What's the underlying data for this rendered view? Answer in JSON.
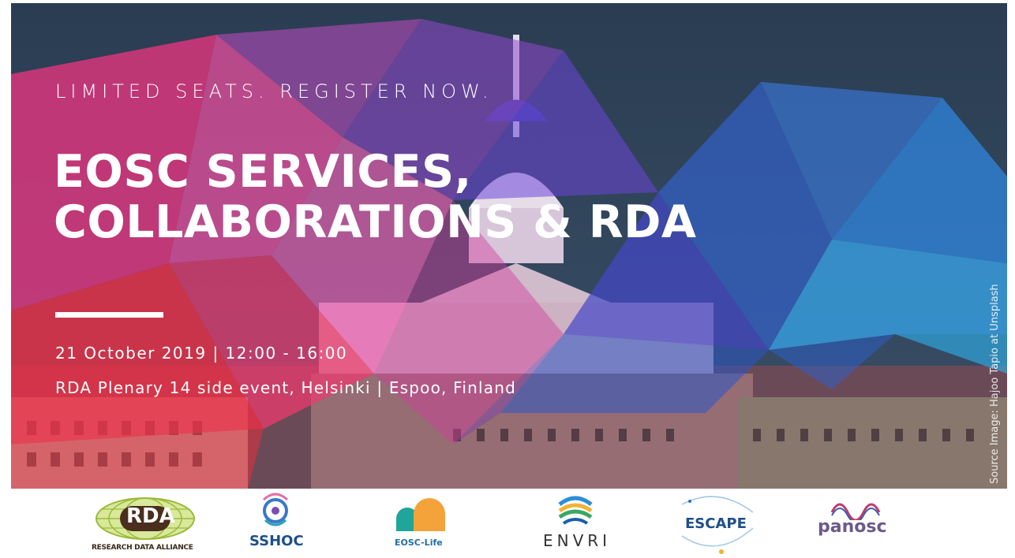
{
  "banner": {
    "tagline": "LIMITED SEATS. REGISTER NOW.",
    "title_line1": "EOSC SERVICES,",
    "title_line2": "COLLABORATIONS & RDA",
    "date_time": "21 October 2019 | 12:00 - 16:00",
    "venue": "RDA Plenary 14 side event, Helsinki | Espoo, Finland",
    "image_credit": "Source Image: Hajoo Tapio at Unsplash"
  },
  "logos": {
    "rda": {
      "mark": "RDA",
      "caption": "RESEARCH DATA ALLIANCE"
    },
    "sshoc": {
      "caption": "SSHOC"
    },
    "eosc_life": {
      "caption": "EOSC-Life"
    },
    "envri": {
      "caption": "ENVRI"
    },
    "escape": {
      "caption": "ESCAPE"
    },
    "panosc": {
      "caption": "panosc"
    }
  },
  "colors": {
    "magenta": "#e8357f",
    "red": "#e8323c",
    "blue": "#2f6fd8",
    "sky": "#38a9f0",
    "navy": "#27384d",
    "white": "#ffffff"
  }
}
